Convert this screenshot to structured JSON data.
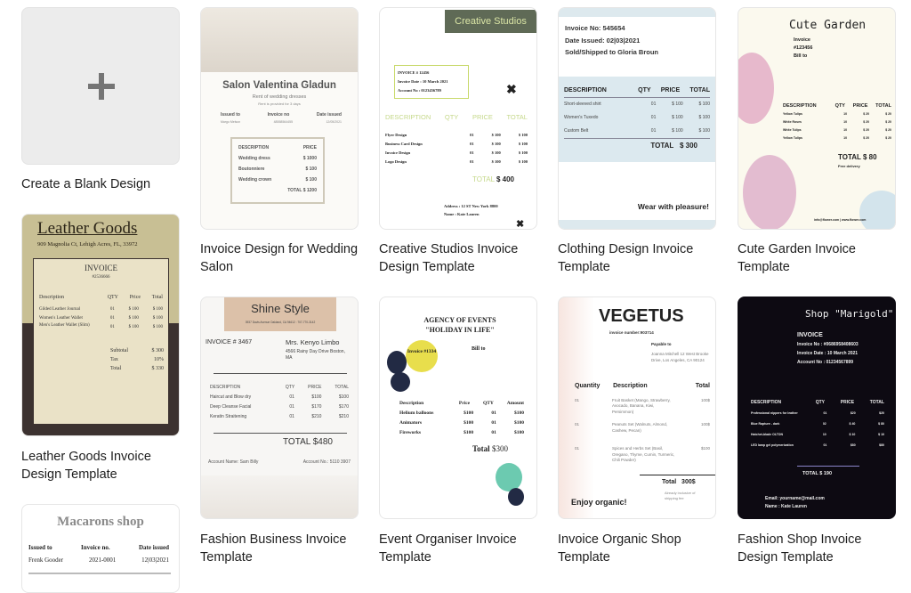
{
  "blank": {
    "label": "Create a Blank Design",
    "icon": "plus-icon"
  },
  "templates": [
    {
      "label": "Invoice Design for Wedding Salon",
      "title": "Salon Valentina Gladun",
      "subtitle": "Rent of wedding dresses",
      "note": "Rent is provided for 3 days",
      "heads": [
        "Issued to",
        "Invoice no",
        "Date issued"
      ],
      "vals": [
        "Margo Melson",
        "48558564455",
        "12/05/2021"
      ],
      "cols": [
        "DESCRIPTION",
        "PRICE"
      ],
      "items": [
        [
          "Wedding dress",
          "$ 1000"
        ],
        [
          "Boutonniere",
          "$ 100"
        ],
        [
          "Wedding crown",
          "$ 100"
        ]
      ],
      "total": "TOTAL  $ 1200"
    },
    {
      "label": "Creative Studios Invoice Design Template",
      "title": "Creative Studios",
      "info": [
        "INVOICE # 12456",
        "Invoice Date : 10 March 2021",
        "Account No : 0123456789"
      ],
      "cols": [
        "DESCRIPTION",
        "QTY",
        "PRICE",
        "TOTAL"
      ],
      "items": [
        [
          "Flyer Design",
          "01",
          "$ 100",
          "$ 100"
        ],
        [
          "Business Card Design",
          "01",
          "$ 100",
          "$ 100"
        ],
        [
          "Invoice Design",
          "01",
          "$ 100",
          "$ 100"
        ],
        [
          "Logo Design",
          "01",
          "$ 100",
          "$ 100"
        ]
      ],
      "total_label": "TOTAL",
      "total": "$ 400",
      "footer": [
        "Address : 12 ST New York 8800",
        "Name : Kate Lauren"
      ]
    },
    {
      "label": "Clothing Design Invoice Template",
      "info": [
        "Invoice No: 545654",
        "Date Issued: 02|03|2021",
        "Sold/Shipped to Gloria Broun"
      ],
      "cols": [
        "DESCRIPTION",
        "QTY",
        "PRICE",
        "TOTAL"
      ],
      "items": [
        [
          "Short-sleeved shirt",
          "01",
          "$ 100",
          "$ 100"
        ],
        [
          "Women's Tuxedo",
          "01",
          "$ 100",
          "$ 100"
        ],
        [
          "Custom Belt",
          "01",
          "$ 100",
          "$ 100"
        ]
      ],
      "total_label": "TOTAL",
      "total": "$ 300",
      "footer": "Wear with pleasure!"
    },
    {
      "label": "Cute Garden Invoice Template",
      "title": "Cute Garden",
      "info": [
        "Invoice",
        "#123456",
        "Bill to"
      ],
      "cols": [
        "DESCRIPTION",
        "QTY",
        "PRICE",
        "TOTAL"
      ],
      "items": [
        [
          "Yellow Tulips",
          "10",
          "$ 20",
          "$ 20"
        ],
        [
          "White Roses",
          "10",
          "$ 20",
          "$ 20"
        ],
        [
          "White Tulips",
          "10",
          "$ 20",
          "$ 20"
        ],
        [
          "Yellow Tulips",
          "10",
          "$ 20",
          "$ 20"
        ]
      ],
      "total": "TOTAL  $ 80",
      "note": "Free delivery",
      "footer": "info@flower.com | www.flower.com"
    },
    {
      "label": "Leather Goods Invoice Design Template",
      "title": "Leather Goods",
      "address": "909 Magnolia Ct, Lehigh Acres, FL, 33972",
      "heading": "INVOICE",
      "number": "#2536666",
      "cols": [
        "Description",
        "QTY",
        "Price",
        "Total"
      ],
      "items": [
        [
          "Gilded Leather Journal",
          "01",
          "$ 100",
          "$ 100"
        ],
        [
          "Women's Leather Wallet",
          "01",
          "$ 100",
          "$ 100"
        ],
        [
          "Men's Leather Wallet (Slim)",
          "01",
          "$ 100",
          "$ 100"
        ]
      ],
      "summary": [
        [
          "Subtotal",
          "$ 300"
        ],
        [
          "Tax",
          "10%"
        ],
        [
          "Total",
          "$ 330"
        ]
      ]
    },
    {
      "label": "Fashion Business Invoice Template",
      "title": "Shine Style",
      "address": "3937 Davis Avenue Oakland, CA 94612 : 707-770-3142",
      "invoice": "INVOICE # 3467",
      "client": "Mrs. Kenyo Limbo",
      "client_addr": "4566 Rainy Day Drive Boston, MA",
      "cols": [
        "DESCRIPTION",
        "QTY",
        "PRICE",
        "TOTAL"
      ],
      "items": [
        [
          "Haircut and Blow dry",
          "01",
          "$100",
          "$100"
        ],
        [
          "Deep Cleanse Facial",
          "01",
          "$170",
          "$170"
        ],
        [
          "Keratin Straitening",
          "01",
          "$210",
          "$210"
        ]
      ],
      "total": "TOTAL  $480",
      "footer": [
        "Account Name: Sam Billy",
        "Account No.: 5110 3907"
      ]
    },
    {
      "label": "Event Organiser Invoice Template",
      "title": "AGENCY OF EVENTS \"HOLIDAY IN LIFE\"",
      "badge": "Invoice #1334",
      "bill": "Bill to",
      "cols": [
        "Description",
        "Price",
        "QTY",
        "Amount"
      ],
      "items": [
        [
          "Helium balloons",
          "$100",
          "01",
          "$100"
        ],
        [
          "Animators",
          "$100",
          "01",
          "$100"
        ],
        [
          "Fireworks",
          "$100",
          "01",
          "$100"
        ]
      ],
      "total_label": "Total",
      "total": "$300"
    },
    {
      "label": "Invoice Organic Shop Template",
      "title": "VEGETUS",
      "number": "invoice number:903714",
      "payable": "Payable to",
      "payable_addr": "Joanna Mitchell 12 West Brooke Drive, Los Angeles, CA 90124",
      "cols": [
        "Quantity",
        "Description",
        "Total"
      ],
      "items": [
        [
          "01",
          "Fruit Basket (Mango, Strawberry, Avocado, Banana, Kiwi, Persimmon)",
          "100$"
        ],
        [
          "01",
          "Peanuts Set (Walnuts, Almond, Cashew, Pecan)",
          "100$"
        ],
        [
          "01",
          "Spices and Herbs Set (Basil, Oregano, Thyme, Cumin, Turmeric, Chili Powder)",
          "$100"
        ]
      ],
      "total_label": "Total",
      "total": "300$",
      "note": "Already inclusive of shipping fee",
      "footer": "Enjoy organic!"
    },
    {
      "label": "Fashion Shop Invoice Design Template",
      "title": "Shop \"Marigold\"",
      "info": [
        "INVOICE",
        "Invoice No : #0686958408603",
        "Invoice Date : 10 March 2021",
        "Account No : 01234567899"
      ],
      "cols": [
        "DESCRIPTION",
        "QTY",
        "PRICE",
        "TOTAL"
      ],
      "items": [
        [
          "Professional nippers for leather",
          "01",
          "$20",
          "$20"
        ],
        [
          "Blue Rapture - dark",
          "02",
          "$ 40",
          "$ 80"
        ],
        [
          "Hatchet-blade OLTON",
          "10",
          "$ 10",
          "$ 10"
        ],
        [
          "LED lamp gel polymerization",
          "01",
          "$80",
          "$80"
        ]
      ],
      "total": "TOTAL  $ 190",
      "footer": [
        "Email: yourname@mail.com",
        "Name : Kate Lauren"
      ]
    },
    {
      "label": "Macarons shop",
      "title": "Macarons shop",
      "heads": [
        "Issued to",
        "Invoice no.",
        "Date issued"
      ],
      "vals": [
        "Frenk Gooder",
        "2021-0001",
        "12|03|2021"
      ]
    }
  ]
}
